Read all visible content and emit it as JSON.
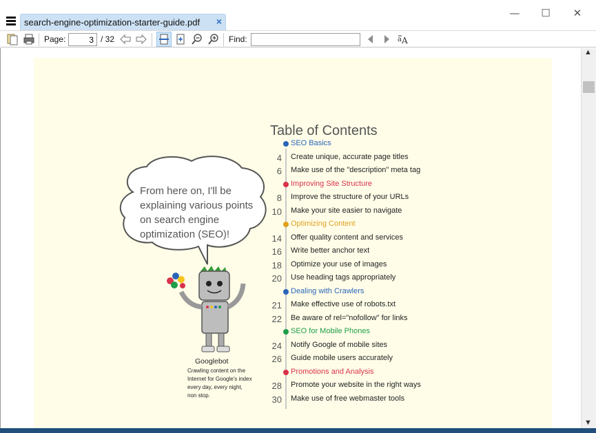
{
  "window": {
    "tab_title": "search-engine-optimization-starter-guide.pdf",
    "tab_close": "×",
    "minimize": "—",
    "maximize": "☐",
    "close": "✕"
  },
  "toolbar": {
    "page_label": "Page:",
    "page_value": "3",
    "page_total": "/ 32",
    "find_label": "Find:",
    "find_value": ""
  },
  "document": {
    "toc_title": "Table of Contents",
    "sections": [
      {
        "type": "header",
        "text": "SEO Basics",
        "color": "#2a64b8"
      },
      {
        "type": "item",
        "num": "4",
        "text": "Create unique, accurate page titles"
      },
      {
        "type": "item",
        "num": "6",
        "text": "Make use of the \"description\" meta tag"
      },
      {
        "type": "header",
        "text": "Improving Site Structure",
        "color": "#d8334a"
      },
      {
        "type": "item",
        "num": "8",
        "text": "Improve the structure of your URLs"
      },
      {
        "type": "item",
        "num": "10",
        "text": "Make your site easier to navigate"
      },
      {
        "type": "header",
        "text": "Optimizing Content",
        "color": "#e0a020"
      },
      {
        "type": "item",
        "num": "14",
        "text": "Offer quality content and services"
      },
      {
        "type": "item",
        "num": "16",
        "text": "Write better anchor text"
      },
      {
        "type": "item",
        "num": "18",
        "text": "Optimize your use of images"
      },
      {
        "type": "item",
        "num": "20",
        "text": "Use heading tags appropriately"
      },
      {
        "type": "header",
        "text": "Dealing with Crawlers",
        "color": "#2a64b8"
      },
      {
        "type": "item",
        "num": "21",
        "text": "Make effective use of robots.txt"
      },
      {
        "type": "item",
        "num": "22",
        "text": "Be aware of rel=\"nofollow\" for links"
      },
      {
        "type": "header",
        "text": "SEO for Mobile Phones",
        "color": "#1e9e4a"
      },
      {
        "type": "item",
        "num": "24",
        "text": "Notify Google of mobile sites"
      },
      {
        "type": "item",
        "num": "26",
        "text": "Guide mobile users accurately"
      },
      {
        "type": "header",
        "text": "Promotions and Analysis",
        "color": "#d8334a"
      },
      {
        "type": "item",
        "num": "28",
        "text": "Promote your website in the right ways"
      },
      {
        "type": "item",
        "num": "30",
        "text": "Make use of free webmaster tools"
      }
    ],
    "bubble_text": "From here on, I'll be explaining various points on search engine optimization (SEO)!",
    "bot_name": "Googlebot",
    "bot_caption": "Crawling content on the Internet for Google's index every day, every night, non stop."
  }
}
